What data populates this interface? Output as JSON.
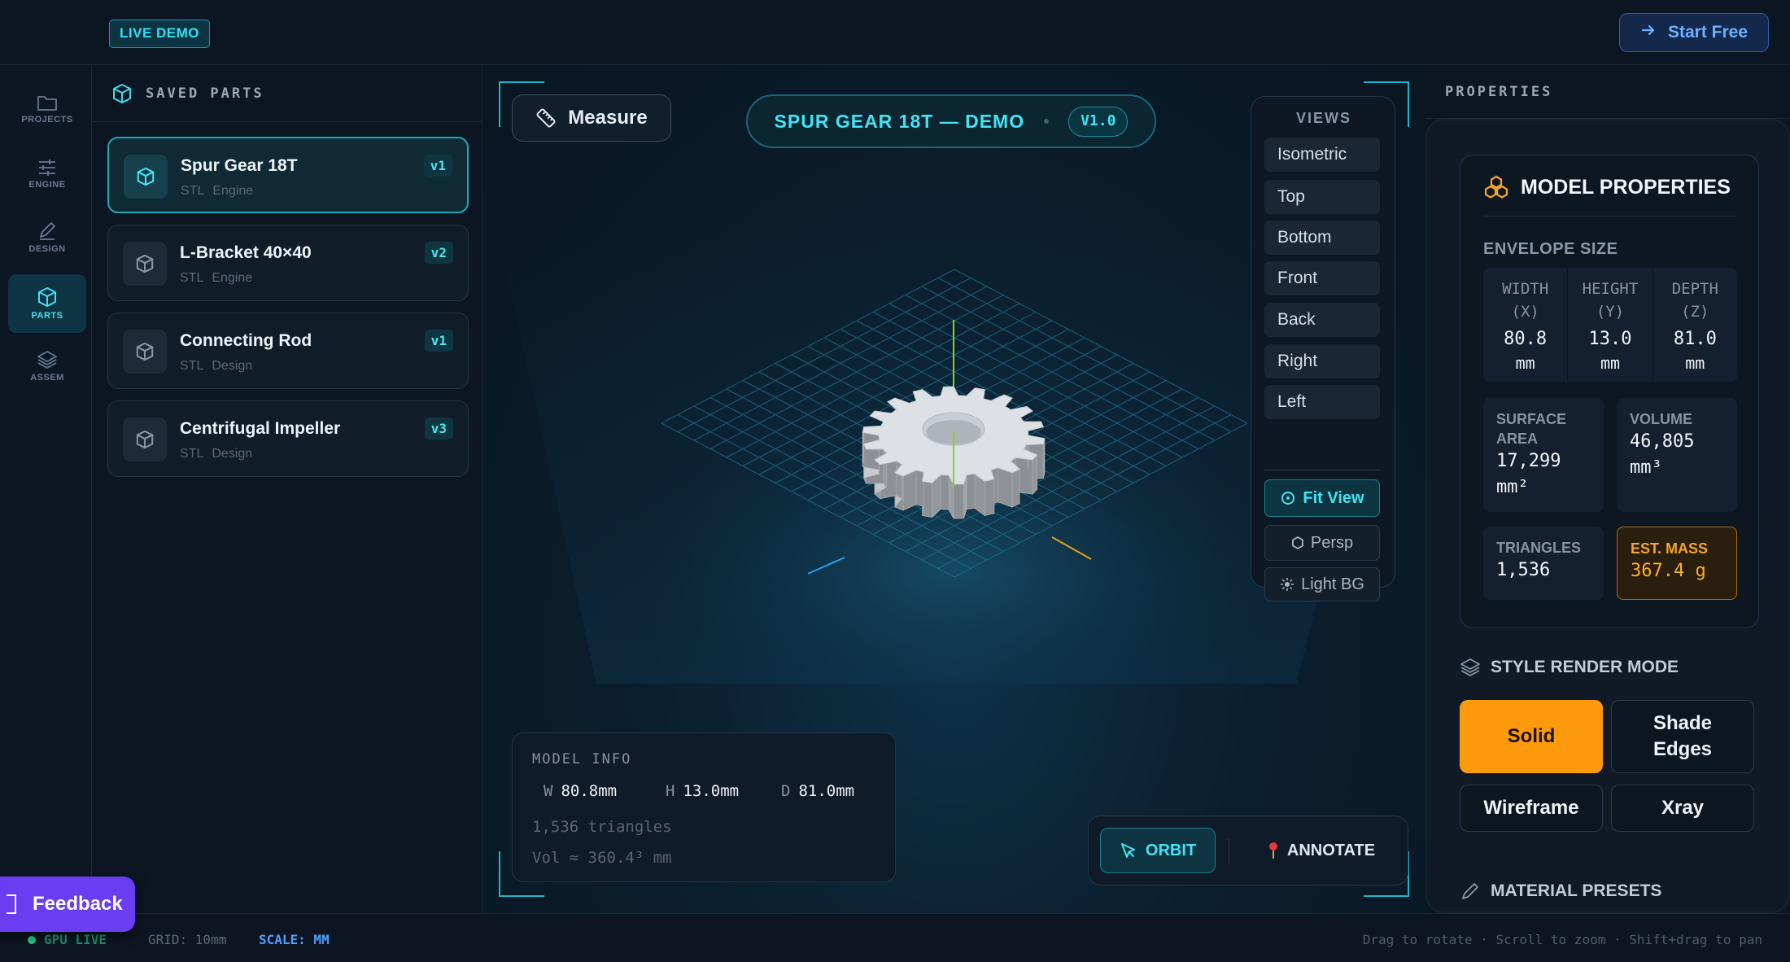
{
  "topbar": {
    "badge": "LIVE DEMO",
    "cta": "Start Free"
  },
  "rail": [
    {
      "label": "PROJECTS",
      "icon": "folder-icon",
      "active": false
    },
    {
      "label": "ENGINE",
      "icon": "sliders-icon",
      "active": false
    },
    {
      "label": "DESIGN",
      "icon": "pencil-icon",
      "active": false
    },
    {
      "label": "PARTS",
      "icon": "cube-icon",
      "active": true
    },
    {
      "label": "ASSEM",
      "icon": "layers-icon",
      "active": false
    }
  ],
  "parts": {
    "title": "SAVED PARTS",
    "items": [
      {
        "name": "Spur Gear 18T",
        "format": "STL",
        "category": "Engine",
        "version": "v1",
        "selected": true
      },
      {
        "name": "L-Bracket 40×40",
        "format": "STL",
        "category": "Engine",
        "version": "v2",
        "selected": false
      },
      {
        "name": "Connecting Rod",
        "format": "STL",
        "category": "Design",
        "version": "v1",
        "selected": false
      },
      {
        "name": "Centrifugal Impeller",
        "format": "STL",
        "category": "Design",
        "version": "v3",
        "selected": false
      }
    ]
  },
  "viewport": {
    "measure": "Measure",
    "title": "SPUR GEAR 18T — DEMO",
    "version": "V1.0",
    "views_title": "VIEWS",
    "views": [
      "Isometric",
      "Top",
      "Bottom",
      "Front",
      "Back",
      "Right",
      "Left"
    ],
    "fit_view": "Fit View",
    "persp": "Persp",
    "light_bg": "Light BG",
    "model_info": {
      "title": "MODEL INFO",
      "w_key": "W",
      "w": "80.8mm",
      "h_key": "H",
      "h": "13.0mm",
      "d_key": "D",
      "d": "81.0mm",
      "triangles": "1,536 triangles",
      "volume": "Vol ≈ 360.4³ mm"
    },
    "tools": {
      "orbit": "ORBIT",
      "annotate": "ANNOTATE"
    },
    "colors": {
      "accent": "#43e3f3",
      "grid": "#1a5a74",
      "gear": "#d4d8dc"
    }
  },
  "properties": {
    "header": "PROPERTIES",
    "card_title": "MODEL PROPERTIES",
    "envelope_label": "ENVELOPE SIZE",
    "envelope": [
      {
        "head1": "WIDTH",
        "head2": "(X)",
        "value": "80.8",
        "unit": "mm"
      },
      {
        "head1": "HEIGHT",
        "head2": "(Y)",
        "value": "13.0",
        "unit": "mm"
      },
      {
        "head1": "DEPTH",
        "head2": "(Z)",
        "value": "81.0",
        "unit": "mm"
      }
    ],
    "surface_area": {
      "l1": "SURFACE",
      "l2": "AREA",
      "v1": "17,299",
      "v2": "mm²"
    },
    "volume": {
      "l1": "VOLUME",
      "v1": "46,805",
      "v2": "mm³"
    },
    "triangles": {
      "label": "TRIANGLES",
      "value": "1,536"
    },
    "mass": {
      "label": "EST. MASS",
      "value": "367.4 g"
    },
    "render_mode_title": "STYLE RENDER MODE",
    "modes": [
      {
        "label": "Solid",
        "active": true
      },
      {
        "label": "Shade Edges",
        "active": false
      },
      {
        "label": "Wireframe",
        "active": false
      },
      {
        "label": "Xray",
        "active": false
      }
    ],
    "material_title": "MATERIAL PRESETS"
  },
  "status": {
    "gpu": "GPU LIVE",
    "grid": "GRID: 10mm",
    "scale": "SCALE: MM",
    "hint": "Drag to rotate · Scroll to zoom · Shift+drag to pan"
  },
  "feedback": "Feedback"
}
